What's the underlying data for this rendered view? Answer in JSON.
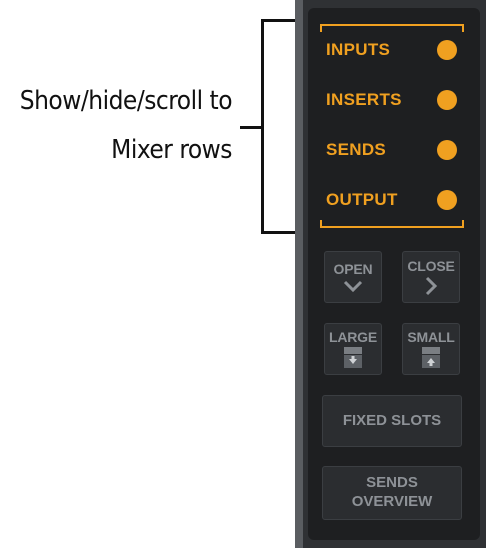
{
  "annotation": {
    "line1": "Show/hide/scroll to",
    "line2": "Mixer rows"
  },
  "mixer_rows": [
    {
      "label": "INPUTS"
    },
    {
      "label": "INSERTS"
    },
    {
      "label": "SENDS"
    },
    {
      "label": "OUTPUT"
    }
  ],
  "controls": {
    "open_label": "OPEN",
    "close_label": "CLOSE",
    "large_label": "LARGE",
    "small_label": "SMALL",
    "fixed_slots_label": "FIXED SLOTS",
    "sends_overview_line1": "SENDS",
    "sends_overview_line2": "OVERVIEW"
  },
  "icons": {
    "open": "chevron-down-icon",
    "close": "chevron-right-icon",
    "large": "expand-down-icon",
    "small": "collapse-up-icon"
  },
  "colors": {
    "accent": "#f0a020",
    "panel_bg": "#1e1f21",
    "button_text": "#8e9297"
  }
}
